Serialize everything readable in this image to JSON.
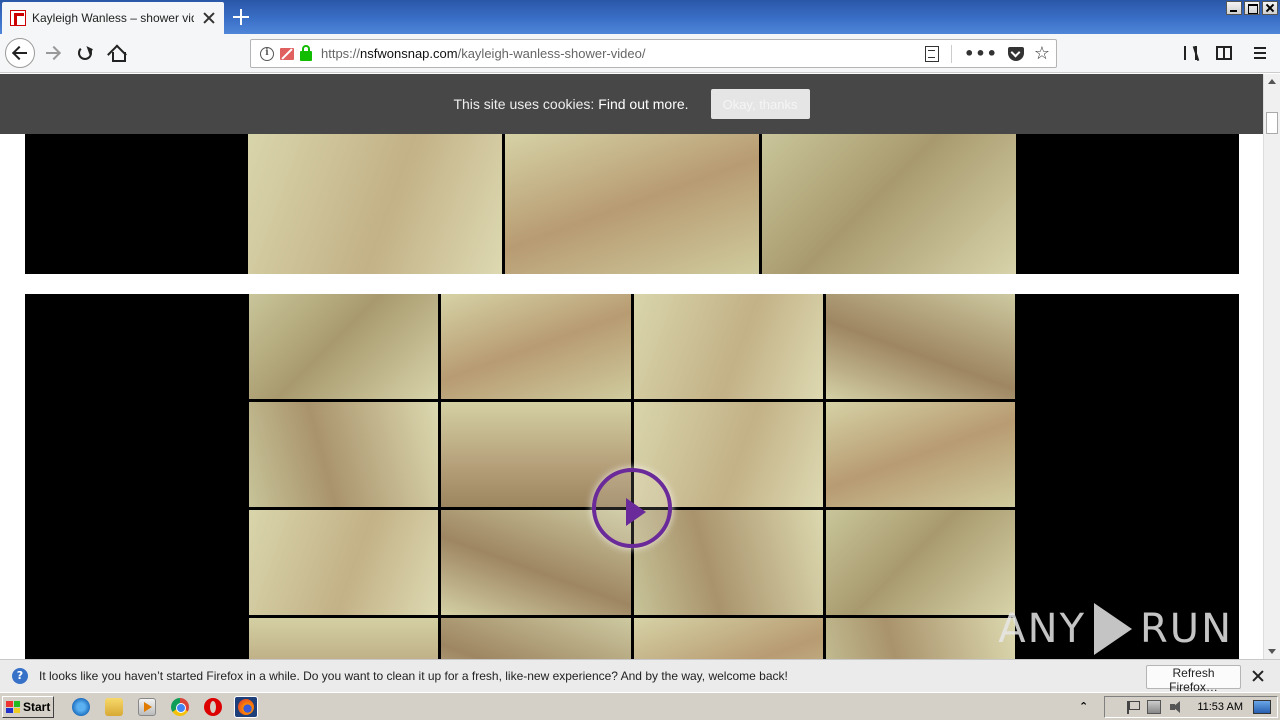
{
  "window": {
    "tab_title": "Kayleigh Wanless – shower video",
    "min_label": "",
    "max_label": "",
    "close_label": ""
  },
  "navbar": {
    "url_scheme_prefix": "https://",
    "url_host": "nsfwonsnap.com",
    "url_path": "/kayleigh-wanless-shower-video/",
    "more_actions": "•••"
  },
  "cookie_banner": {
    "text": "This site uses cookies:",
    "link": "Find out more.",
    "button": "Okay, thanks"
  },
  "watermark": {
    "left": "ANY",
    "right": "RUN"
  },
  "notification": {
    "message": "It looks like you haven’t started Firefox in a while. Do you want to clean it up for a fresh, like-new experience? And by the way, welcome back!",
    "button": "Refresh Firefox…"
  },
  "taskbar": {
    "start_label": "Start",
    "clock": "11:53 AM",
    "tray_chevron": "⌃"
  },
  "icons": {
    "star": "☆",
    "help": "?",
    "info": "i"
  }
}
